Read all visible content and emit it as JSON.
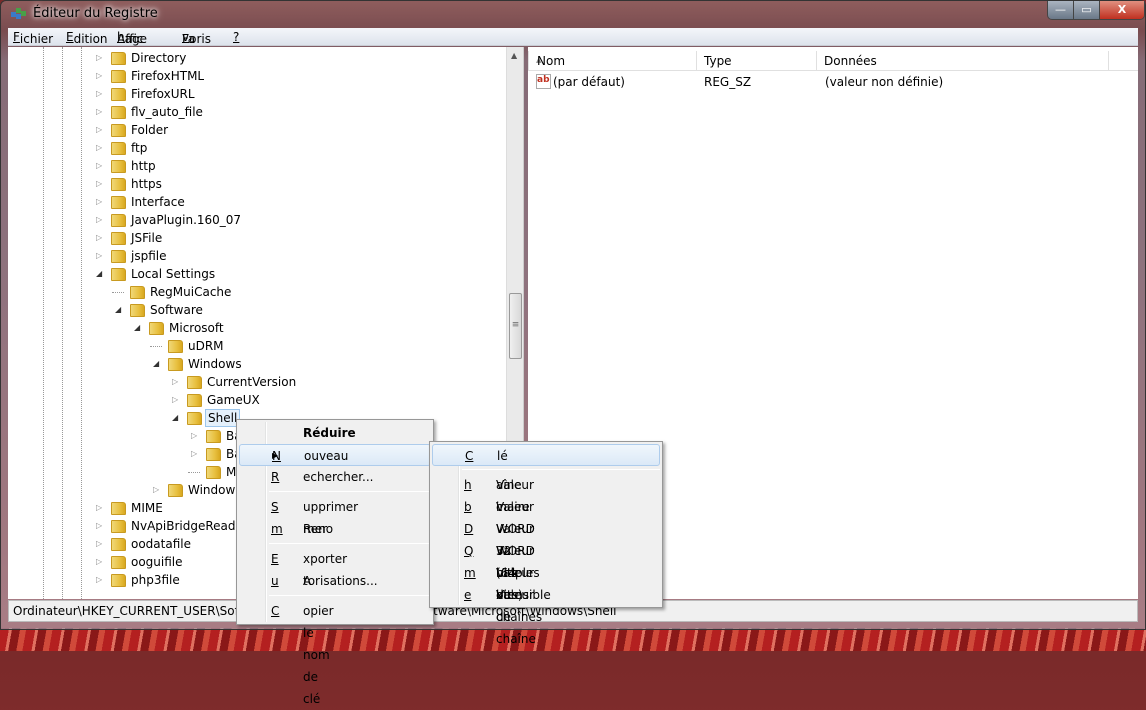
{
  "window": {
    "title": "Éditeur du Registre",
    "controls": {
      "minimize": "—",
      "maximize": "▭",
      "close": "X"
    }
  },
  "menubar": [
    {
      "pre": "",
      "u": "F",
      "post": "ichier"
    },
    {
      "pre": "",
      "u": "E",
      "post": "dition"
    },
    {
      "pre": "Affic",
      "u": "h",
      "post": "age"
    },
    {
      "pre": "Fa",
      "u": "v",
      "post": "oris"
    },
    {
      "pre": "",
      "u": "?",
      "post": ""
    }
  ],
  "tree": [
    {
      "label": "Directory",
      "level": 0,
      "state": "collapsed"
    },
    {
      "label": "FirefoxHTML",
      "level": 0,
      "state": "collapsed"
    },
    {
      "label": "FirefoxURL",
      "level": 0,
      "state": "collapsed"
    },
    {
      "label": "flv_auto_file",
      "level": 0,
      "state": "collapsed"
    },
    {
      "label": "Folder",
      "level": 0,
      "state": "collapsed"
    },
    {
      "label": "ftp",
      "level": 0,
      "state": "collapsed"
    },
    {
      "label": "http",
      "level": 0,
      "state": "collapsed"
    },
    {
      "label": "https",
      "level": 0,
      "state": "collapsed"
    },
    {
      "label": "Interface",
      "level": 0,
      "state": "collapsed"
    },
    {
      "label": "JavaPlugin.160_07",
      "level": 0,
      "state": "collapsed"
    },
    {
      "label": "JSFile",
      "level": 0,
      "state": "collapsed"
    },
    {
      "label": "jspfile",
      "level": 0,
      "state": "collapsed"
    },
    {
      "label": "Local Settings",
      "level": 0,
      "state": "expanded"
    },
    {
      "label": "RegMuiCache",
      "level": 1,
      "state": "leaf"
    },
    {
      "label": "Software",
      "level": 1,
      "state": "expanded"
    },
    {
      "label": "Microsoft",
      "level": 2,
      "state": "expanded"
    },
    {
      "label": "uDRM",
      "level": 3,
      "state": "leaf"
    },
    {
      "label": "Windows",
      "level": 3,
      "state": "expanded"
    },
    {
      "label": "CurrentVersion",
      "level": 4,
      "state": "collapsed"
    },
    {
      "label": "GameUX",
      "level": 4,
      "state": "collapsed"
    },
    {
      "label": "Shell",
      "level": 4,
      "state": "expanded",
      "selected": true
    },
    {
      "label": "Ba",
      "level": 5,
      "state": "collapsed"
    },
    {
      "label": "Ba",
      "level": 5,
      "state": "collapsed"
    },
    {
      "label": "M",
      "level": 5,
      "state": "leaf"
    },
    {
      "label": "Windows",
      "level": 3,
      "state": "collapsed"
    },
    {
      "label": "MIME",
      "level": 0,
      "state": "collapsed"
    },
    {
      "label": "NvApiBridgeReader",
      "level": 0,
      "state": "collapsed"
    },
    {
      "label": "oodatafile",
      "level": 0,
      "state": "collapsed"
    },
    {
      "label": "ooguifile",
      "level": 0,
      "state": "collapsed"
    },
    {
      "label": "php3file",
      "level": 0,
      "state": "collapsed"
    }
  ],
  "values": {
    "columns": [
      "Nom",
      "Type",
      "Données"
    ],
    "rows": [
      {
        "icon": "string-value-icon",
        "icon_text": "ab",
        "name": "(par défaut)",
        "type": "REG_SZ",
        "data": "(valeur non définie)"
      }
    ]
  },
  "status": "Ordinateur\\HKEY_CURRENT_USER\\Software\\Classes\\Local Settings\\Software\\Microsoft\\Windows\\Shell",
  "context_menu": [
    {
      "pre": "",
      "u": "",
      "post": "Réduire",
      "bold": true
    },
    {
      "pre": "",
      "u": "N",
      "post": "ouveau",
      "submenu": true,
      "highlight": true
    },
    {
      "pre": "",
      "u": "R",
      "post": "echercher..."
    },
    {
      "sep": true
    },
    {
      "pre": "",
      "u": "S",
      "post": "upprimer"
    },
    {
      "pre": "Reno",
      "u": "m",
      "post": "mer"
    },
    {
      "sep": true
    },
    {
      "pre": "",
      "u": "E",
      "post": "xporter"
    },
    {
      "pre": "A",
      "u": "u",
      "post": "torisations..."
    },
    {
      "sep": true
    },
    {
      "pre": "",
      "u": "C",
      "post": "opier le nom de clé"
    }
  ],
  "submenu": [
    {
      "pre": "",
      "u": "C",
      "post": "lé",
      "highlight": true
    },
    {
      "sep": true
    },
    {
      "pre": "Valeur c",
      "u": "h",
      "post": "aîne"
    },
    {
      "pre": "Valeur ",
      "u": "b",
      "post": "inaire"
    },
    {
      "pre": "Valeur ",
      "u": "D",
      "post": "WORD 32 bits"
    },
    {
      "pre": "Valeur ",
      "u": "Q",
      "post": "WORD (64 bits)"
    },
    {
      "pre": "Valeur de chaînes ",
      "u": "m",
      "post": "ultiples"
    },
    {
      "pre": "Valeur de chaîne ",
      "u": "e",
      "post": "xtensible"
    }
  ],
  "colors": {
    "selection": "#e4f0fb",
    "menu_highlight": "#dbe9f7",
    "close_button": "#c03020"
  }
}
